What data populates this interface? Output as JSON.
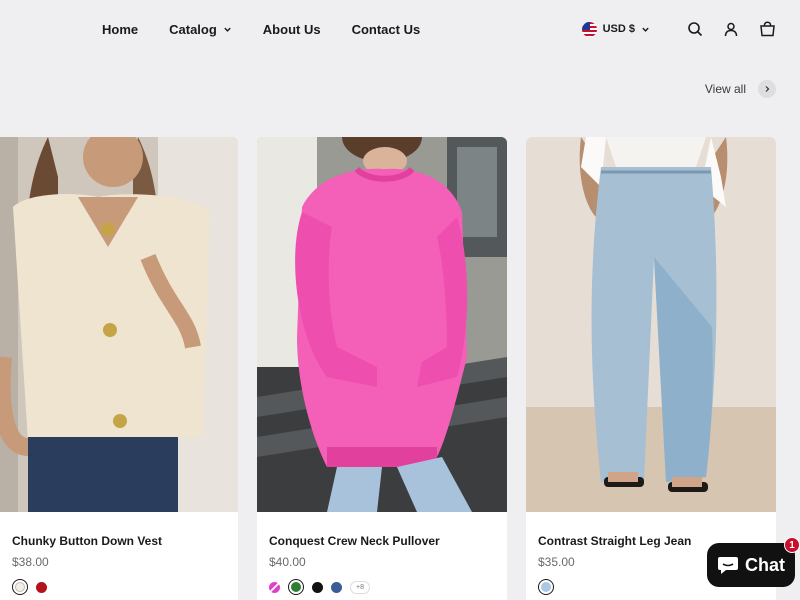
{
  "nav": {
    "items": [
      {
        "label": "Home",
        "dropdown": false
      },
      {
        "label": "Catalog",
        "dropdown": true
      },
      {
        "label": "About Us",
        "dropdown": false
      },
      {
        "label": "Contact Us",
        "dropdown": false
      }
    ]
  },
  "header": {
    "currency": "USD $",
    "icons": [
      "search-icon",
      "account-icon",
      "cart-icon"
    ]
  },
  "collection": {
    "view_all_label": "View all"
  },
  "products": [
    {
      "title": "Chunky Button Down Vest",
      "price": "$38.00",
      "swatches": [
        "#f3efe6",
        "#b3121b"
      ],
      "active_swatch": 0,
      "more": ""
    },
    {
      "title": "Conquest Crew Neck Pullover",
      "price": "$40.00",
      "swatches": [
        "#e040c8",
        "#2f7d32",
        "#111111",
        "#3a5d96"
      ],
      "active_swatch": 1,
      "more": "+8"
    },
    {
      "title": "Contrast Straight Leg Jean",
      "price": "$35.00",
      "swatches": [
        "#a9c8e3"
      ],
      "active_swatch": 0,
      "more": ""
    }
  ],
  "chat": {
    "label": "Chat",
    "badge": "1"
  },
  "colors": {
    "background": "#efeef0",
    "card": "#ffffff",
    "chat_button": "#111111",
    "badge": "#c8102e"
  }
}
